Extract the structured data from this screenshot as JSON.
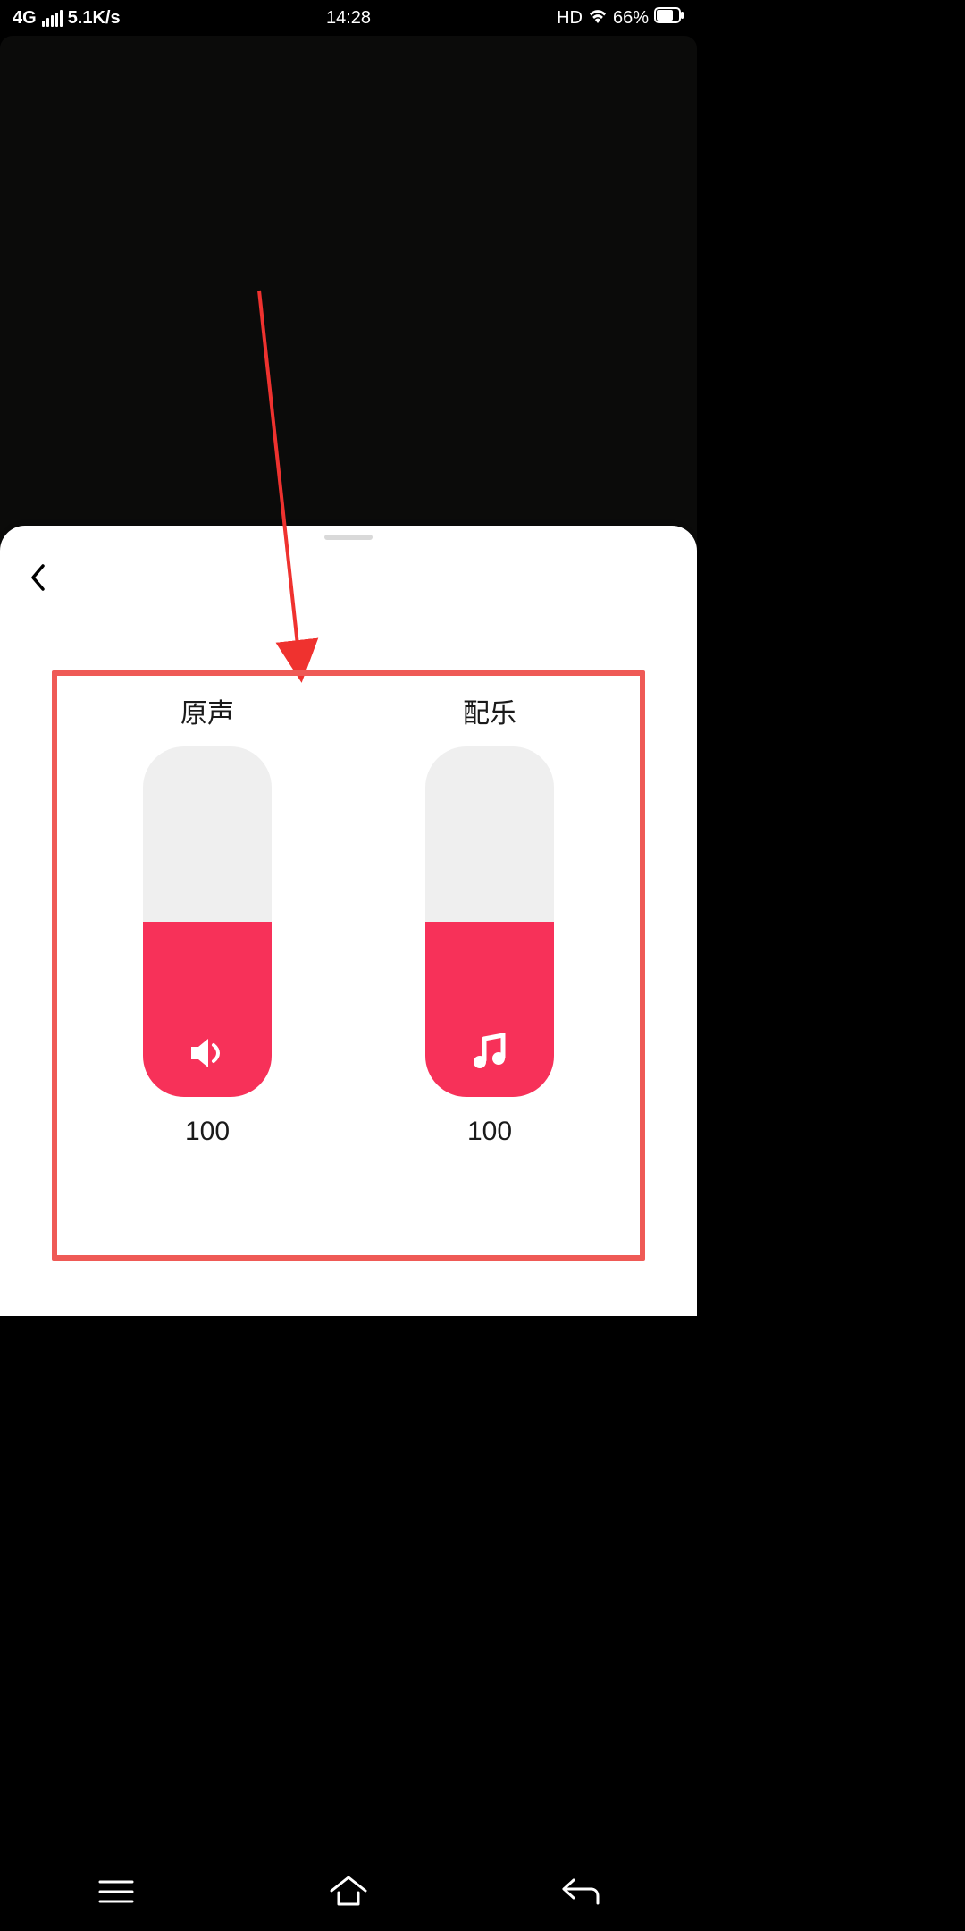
{
  "status": {
    "network": "4G",
    "speed": "5.1K/s",
    "time": "14:28",
    "hd": "HD",
    "battery_pct": "66%"
  },
  "sheet": {
    "controls": [
      {
        "label": "原声",
        "value": "100",
        "fill_pct": 50,
        "icon": "speaker"
      },
      {
        "label": "配乐",
        "value": "100",
        "fill_pct": 50,
        "icon": "music"
      }
    ]
  },
  "colors": {
    "accent": "#f73159",
    "annotation": "#ef5a56"
  }
}
